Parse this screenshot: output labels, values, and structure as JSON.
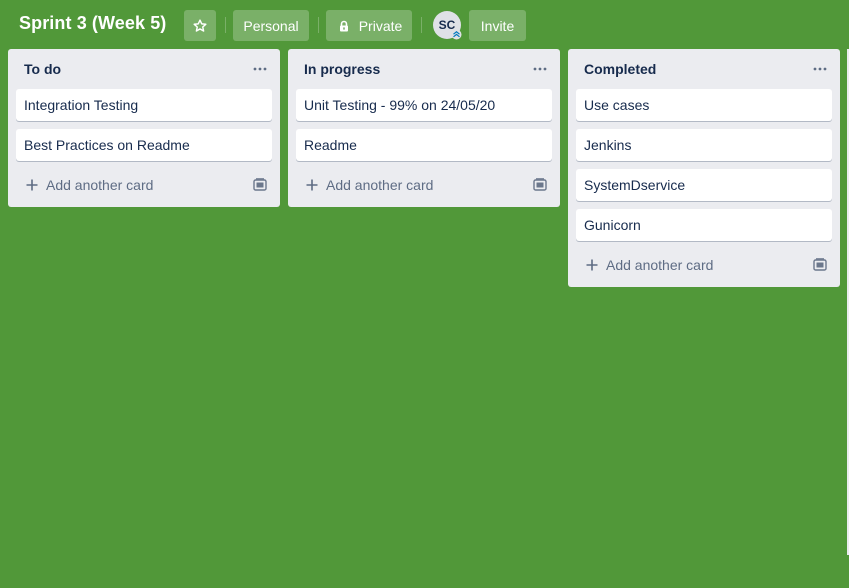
{
  "board": {
    "title": "Sprint 3 (Week 5)",
    "background_color": "#519839",
    "star_icon": "star-icon",
    "visibility_team": "Personal",
    "visibility": "Private",
    "visibility_icon": "lock-icon",
    "member_initials": "SC",
    "invite_label": "Invite"
  },
  "lists": [
    {
      "title": "To do",
      "menu_icon": "ellipsis-icon",
      "cards": [
        "Integration Testing",
        "Best Practices on Readme"
      ],
      "add_card_label": "Add another card",
      "template_icon": "card-template-icon"
    },
    {
      "title": "In progress",
      "menu_icon": "ellipsis-icon",
      "cards": [
        "Unit Testing - 99% on 24/05/20",
        "Readme"
      ],
      "add_card_label": "Add another card",
      "template_icon": "card-template-icon"
    },
    {
      "title": "Completed",
      "menu_icon": "ellipsis-icon",
      "cards": [
        "Use cases",
        "Jenkins",
        "SystemDservice",
        "Gunicorn"
      ],
      "add_card_label": "Add another card",
      "template_icon": "card-template-icon"
    }
  ]
}
